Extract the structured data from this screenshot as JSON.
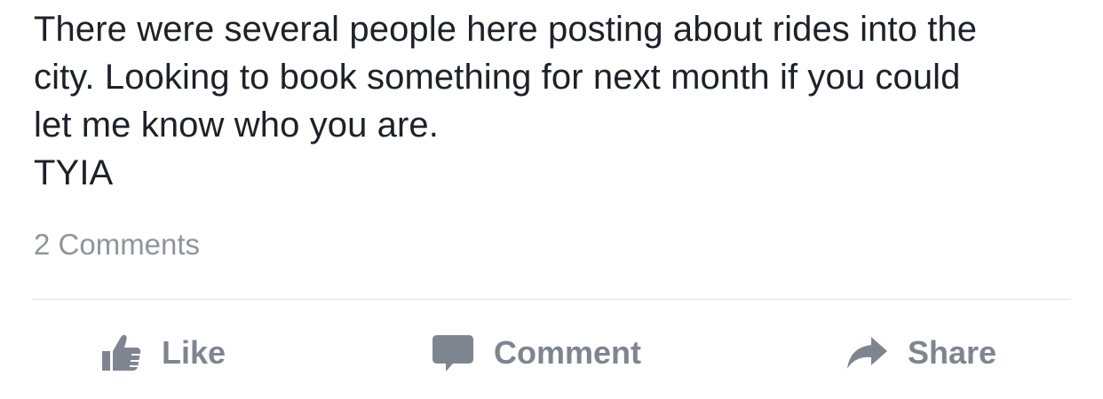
{
  "post": {
    "lines": [
      "There were several people here posting about rides into the",
      "city. Looking to book something for next month if you could",
      "let me know who you are.",
      "TYIA"
    ],
    "comment_count_label": "2 Comments"
  },
  "actions": {
    "like": {
      "label": "Like",
      "icon": "thumbs-up-icon"
    },
    "comment": {
      "label": "Comment",
      "icon": "speech-bubble-icon"
    },
    "share": {
      "label": "Share",
      "icon": "share-arrow-icon"
    }
  },
  "colors": {
    "text": "#1d2129",
    "muted": "#90949c",
    "action": "#7f8590",
    "divider": "#dddfe2"
  }
}
